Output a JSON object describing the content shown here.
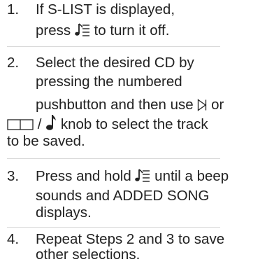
{
  "steps": [
    {
      "num": "1.",
      "line1": "If S-LIST is displayed,",
      "line2_pre": "press",
      "line2_icon": "list-music-icon",
      "line2_post": "to turn it off."
    },
    {
      "num": "2.",
      "line1": "Select the desired CD by",
      "line2": "pressing the numbered",
      "line3_pre": "pushbutton and then use",
      "line3_icon": "seek-right-icon",
      "line3_post": "or",
      "line4_icon1": "tune-box-icon",
      "line4_sep": "/",
      "line4_icon2": "music-note-icon",
      "line4_post": "knob to select the track",
      "line5": "to be saved."
    },
    {
      "num": "3.",
      "line1_pre": "Press and hold",
      "line1_icon": "list-music-icon",
      "line1_post": "until a beep",
      "line2": "sounds and ADDED SONG",
      "line3": "displays."
    },
    {
      "num": "4.",
      "line1": "Repeat Steps 2 and 3 to save",
      "line2": "other selections."
    }
  ]
}
